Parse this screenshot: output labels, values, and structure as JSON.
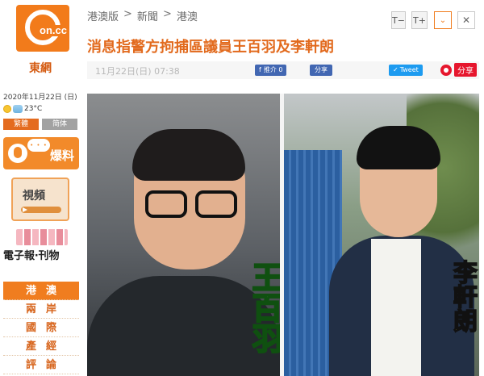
{
  "site": {
    "logo_text": "on.cc",
    "logo_subtitle": "東網"
  },
  "sidebar": {
    "date": "2020年11月22日 (日)",
    "temperature": "23°C",
    "lang_traditional": "繁體",
    "lang_simplified": "简体",
    "breaking_label": "爆料",
    "video_label": "視頻",
    "epaper_label": "電子報‧刊物",
    "nav_items": [
      {
        "label": "港澳"
      },
      {
        "label": "兩岸"
      },
      {
        "label": "國際"
      },
      {
        "label": "產經"
      },
      {
        "label": "評論"
      }
    ]
  },
  "breadcrumb": [
    "港澳版",
    "新聞",
    "港澳"
  ],
  "toolbar": {
    "font_smaller": "T−",
    "font_larger": "T+",
    "more": "⌄",
    "close": "✕"
  },
  "article": {
    "headline": "消息指警方拘捕區議員王百羽及李軒朗",
    "timestamp": "11月22日(日) 07:38",
    "fb_like": "推介 0",
    "fb_share": "分享",
    "tweet": "Tweet",
    "weibo_share": "分享",
    "photo": {
      "name_left": "王百羽",
      "name_right": "李軒朗"
    }
  }
}
